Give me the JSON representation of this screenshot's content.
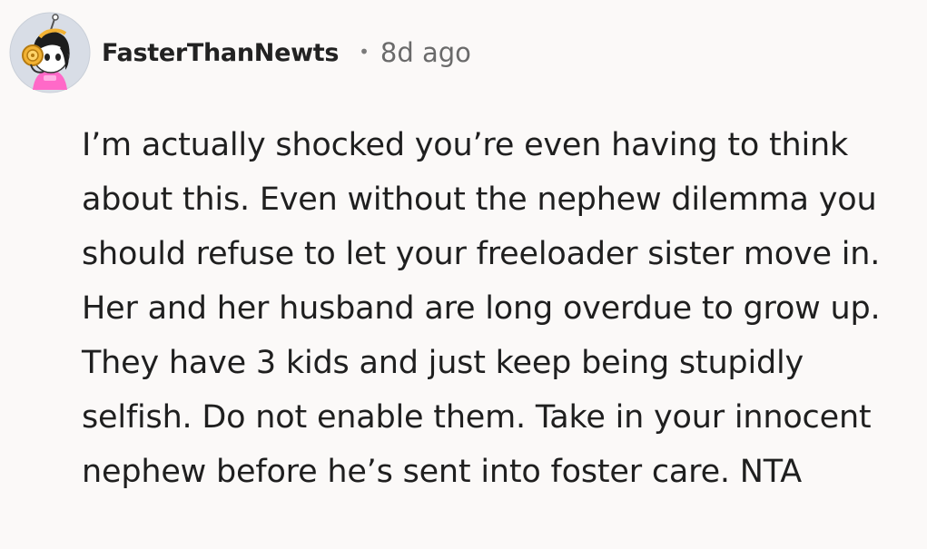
{
  "comment": {
    "author": "FasterThanNewts",
    "separator": "•",
    "timestamp": "8d ago",
    "avatar_icon": "cartoon-avatar-with-headphones",
    "body": "I’m actually shocked you’re even having to think about this. Even without the nephew dilemma you should refuse to let your freeloader sister move in. Her and her husband are long overdue to grow up. They have 3 kids and just keep being stupidly selfish. Do not enable them. Take in your innocent nephew before he’s sent into foster care. NTA"
  },
  "colors": {
    "background": "#fbf9f8",
    "text": "#1f1f1f",
    "meta": "#6a6a6a",
    "avatar_bg": "#d8dde6",
    "avatar_shirt": "#ff69c8",
    "avatar_headphones": "#f2b233"
  }
}
